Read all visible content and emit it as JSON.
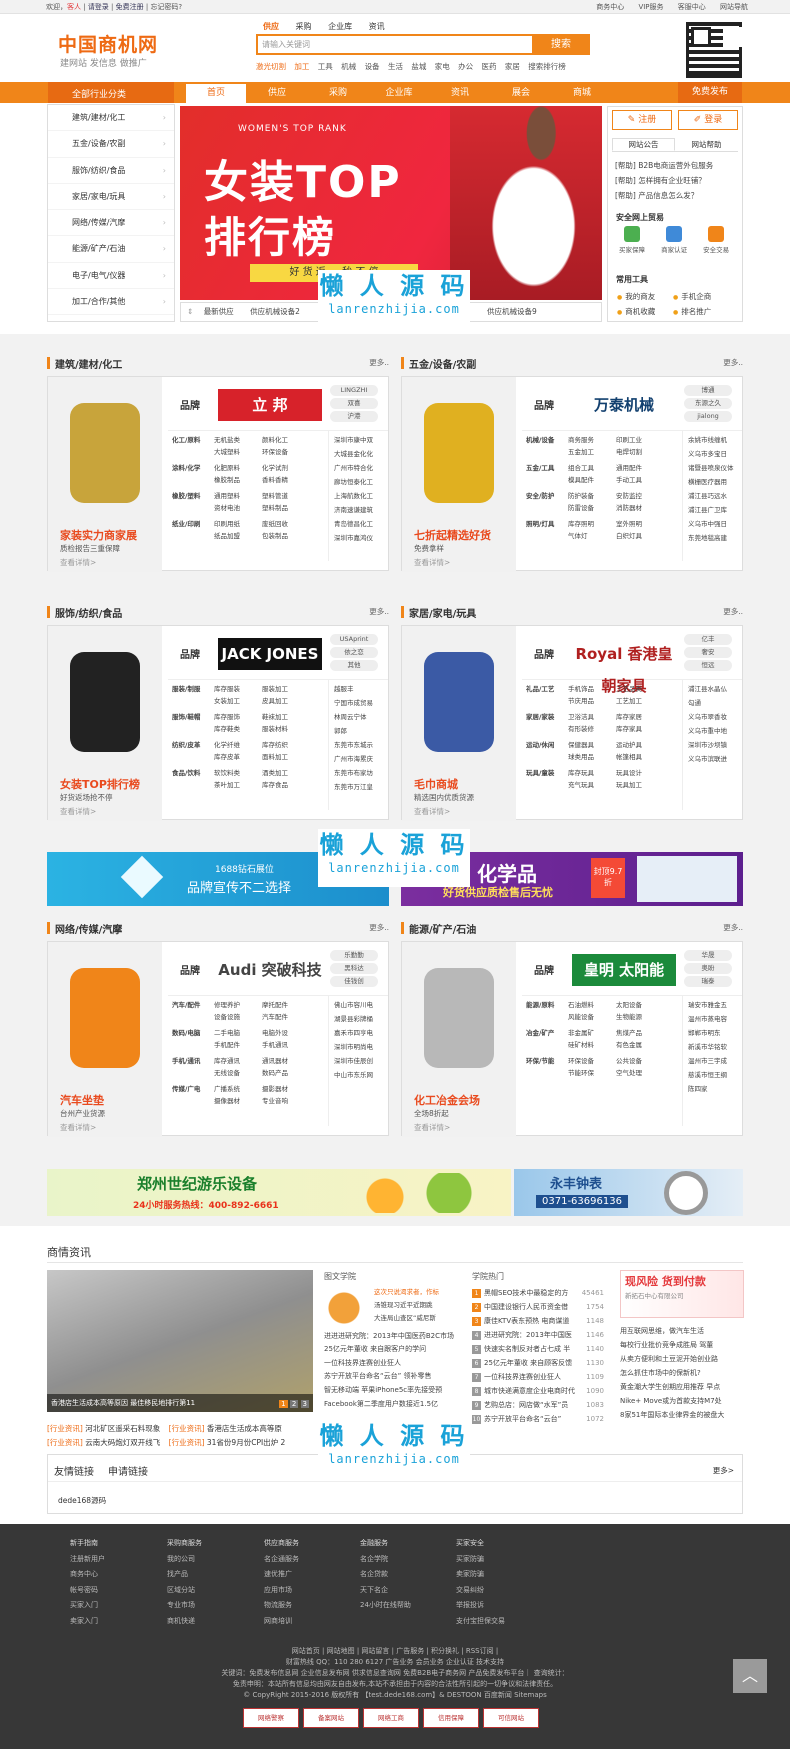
{
  "topbar": {
    "left_prefix": "欢迎，",
    "guest": "客人",
    "login": "请登录",
    "register": "免费注册",
    "forgot": "忘记密码?",
    "right": [
      "商务中心",
      "VIP服务",
      "客服中心",
      "网站导航"
    ]
  },
  "header": {
    "logo": "中国商机网",
    "slogan": "建网站 发信息 做推广",
    "search_tabs": [
      "供应",
      "采购",
      "企业库",
      "资讯"
    ],
    "search_placeholder": "请输入关键词",
    "search_button": "搜索",
    "hot": [
      "激光切割",
      "加工",
      "工具",
      "机械",
      "设备",
      "生活",
      "盐城",
      "家电",
      "办公",
      "医药",
      "家居",
      "搜索排行榜"
    ]
  },
  "nav": {
    "category": "全部行业分类",
    "items": [
      "首页",
      "供应",
      "采购",
      "企业库",
      "资讯",
      "展会",
      "商城"
    ],
    "right": "免费发布"
  },
  "categories": [
    "建筑/建材/化工",
    "五金/设备/农副",
    "服饰/纺织/食品",
    "家居/家电/玩具",
    "网络/传媒/汽摩",
    "能源/矿产/石油",
    "电子/电气/仪器",
    "加工/合作/其他"
  ],
  "banner": {
    "t1": "WOMEN'S TOP RANK",
    "t2": "女装TOP",
    "t3": "排行榜",
    "t4": "好 货 返 … 秒 不 停"
  },
  "ticker": {
    "label": "最新供应",
    "items": [
      "供应机械设备2",
      "供应机械设备9"
    ]
  },
  "userbox": {
    "register": "注册",
    "login": "登录",
    "tabs": [
      "网站公告",
      "网站帮助"
    ],
    "notices": [
      "[帮助] B2B电商运营外包服务",
      "[帮助] 怎样拥有企业旺铺？",
      "[帮助] 产品信息怎么发？"
    ],
    "trade_title": "安全网上贸易",
    "trade_items": [
      "买家保障",
      "商家认证",
      "安全交易"
    ],
    "tools_title": "常用工具",
    "tools": [
      "我的商友",
      "手机企商",
      "商机收藏",
      "排名推广"
    ]
  },
  "sections": [
    {
      "title": "建筑/建材/化工",
      "more": "更多..",
      "caption": "家装实力商家展",
      "sub": "质检报告三重保障",
      "detail": "查看详情>",
      "brand_label": "品牌",
      "brand_logo": "立 邦",
      "tags": [
        "LINGZHI",
        "双喜",
        "沪港"
      ],
      "rows": [
        [
          "化工/原料",
          "无机盐类",
          "颜料化工"
        ],
        [
          "涂料/化学",
          "化肥原料",
          "化学试剂"
        ],
        [
          "橡胶/塑料",
          "通用塑料",
          "塑料管道"
        ],
        [
          "纸业/印刷",
          "印刷用纸",
          "废纸回收"
        ]
      ],
      "col2": [
        "大城塑料",
        "橡胶制品",
        "资材电池",
        "纸品加盟"
      ],
      "col3": [
        "环保设备",
        "香料香精",
        "塑料制品",
        "包装制品"
      ],
      "places": [
        "深圳市康中双",
        "大城县金化化",
        "广州市特合化",
        "廊坊恒泰化工",
        "上海航数化工",
        "济南速谦建筑",
        "青岛德昌化工",
        "深圳市嘉鸿仪"
      ]
    },
    {
      "title": "五金/设备/农副",
      "more": "更多..",
      "caption": "七折起精选好货",
      "sub": "免费拿样",
      "detail": "查看详情>",
      "brand_label": "品牌",
      "brand_logo": "万泰机械",
      "tags": [
        "博通",
        "东源之久",
        "jialong"
      ],
      "rows": [
        [
          "机械/设备",
          "商务服务",
          "印刷工业"
        ],
        [
          "五金/工具",
          "组合工具",
          "通用配件"
        ],
        [
          "安全/防护",
          "防护装备",
          "安防监控"
        ],
        [
          "照明/灯具",
          "库存照明",
          "室外照明"
        ]
      ],
      "col2": [
        "五金加工",
        "模具配件",
        "防雷设备",
        "气体灯"
      ],
      "col3": [
        "电焊切割",
        "手动工具",
        "消防器材",
        "白织灯具"
      ],
      "places": [
        "余姚市线缠机",
        "义乌市多宝日",
        "诸暨县喷泉仪体",
        "横栅医疗器用",
        "浦江县巧远水",
        "浦江县广卫库",
        "义乌市中强日",
        "东莞地毯高建"
      ]
    },
    {
      "title": "服饰/纺织/食品",
      "more": "更多..",
      "caption": "女装TOP排行榜",
      "sub": "好货返场抢不停",
      "detail": "查看详情>",
      "brand_label": "品牌",
      "brand_logo": "JACK JONES",
      "tags": [
        "USAprint",
        "依之恋",
        "其他"
      ],
      "rows": [
        [
          "服装/制服",
          "库存服装",
          "服装加工"
        ],
        [
          "服饰/鞋帽",
          "库存服饰",
          "鞋袜加工"
        ],
        [
          "纺织/皮革",
          "化学纤维",
          "库存纺织"
        ],
        [
          "食品/饮料",
          "软饮料类",
          "酒类加工"
        ]
      ],
      "col2": [
        "女装加工",
        "库存鞋类",
        "库存皮革",
        "茶叶加工"
      ],
      "col3": [
        "皮具加工",
        "服装材料",
        "面料加工",
        "库存食品"
      ],
      "places": [
        "越服丰",
        "宁国市成贸易",
        "林周云宁体",
        "郭郎",
        "东莞市东城示",
        "广州市海累庆",
        "东莞市布家坊",
        "东莞市万江皇"
      ]
    },
    {
      "title": "家居/家电/玩具",
      "more": "更多..",
      "caption": "毛巾商城",
      "sub": "精选国内优质货源",
      "detail": "查看详情>",
      "brand_label": "品牌",
      "brand_logo": "Royal 香港皇朝家具",
      "tags": [
        "亿丰",
        "奢安",
        "恒远"
      ],
      "rows": [
        [
          "礼品/工艺",
          "手机饰品",
          "工艺品类"
        ],
        [
          "家居/家装",
          "卫浴洁具",
          "库存家居"
        ],
        [
          "运动/休闲",
          "保健器具",
          "运动护具"
        ],
        [
          "玩具/童装",
          "库存玩具",
          "玩具设计"
        ]
      ],
      "col2": [
        "节庆用品",
        "有形装修",
        "球类用品",
        "充气玩具"
      ],
      "col3": [
        "工艺加工",
        "库存家具",
        "帐篷相具",
        "玩具加工"
      ],
      "places": [
        "浦江县水晶仏",
        "勾通",
        "义乌市翠香妆",
        "义乌市重中地",
        "深圳市沙坝镇",
        "义乌市滨联进",
        "",
        ""
      ]
    },
    {
      "title": "网络/传媒/汽摩",
      "more": "更多..",
      "caption": "汽车坐垫",
      "sub": "台州产业货源",
      "detail": "查看详情>",
      "brand_label": "品牌",
      "brand_logo": "Audi 突破科技",
      "tags": [
        "乐勤勤",
        "黑科达",
        "佳钱创"
      ],
      "rows": [
        [
          "汽车/配件",
          "修理养护",
          "摩托配件"
        ],
        [
          "数码/电脑",
          "二手电脑",
          "电脑外设"
        ],
        [
          "手机/通讯",
          "库存通讯",
          "通讯器材"
        ],
        [
          "传媒/广电",
          "广播系统",
          "摄影器材"
        ]
      ],
      "col2": [
        "设备设施",
        "手机配件",
        "无线设备",
        "摄像器材"
      ],
      "col3": [
        "汽车配件",
        "手机通讯",
        "数码产品",
        "专业音响"
      ],
      "places": [
        "佛山市容川电",
        "湖景县彩牌桶",
        "嘉禾市四亨电",
        "深圳市明尚电",
        "深圳市佳辰创",
        "中山市东乐网",
        "",
        ""
      ]
    },
    {
      "title": "能源/矿产/石油",
      "more": "更多..",
      "caption": "化工冶金会场",
      "sub": "全场8折起",
      "detail": "查看详情>",
      "brand_label": "品牌",
      "brand_logo": "皇明 太阳能",
      "tags": [
        "华晟",
        "奥盼",
        "瑞泰"
      ],
      "rows": [
        [
          "能源/原料",
          "石油燃料",
          "太阳设备"
        ],
        [
          "冶金/矿产",
          "非金属矿",
          "焦煤产品"
        ],
        [
          "环保/节能",
          "环保设备",
          "公共设备"
        ],
        [
          "",
          "",
          ""
        ]
      ],
      "col2": [
        "风能设备",
        "硅矿材料",
        "节能环保"
      ],
      "col3": [
        "生物能源",
        "有色金属",
        "空气处理"
      ],
      "places": [
        "瑞安市雅金五",
        "温州市蒸电容",
        "邯郸市明东",
        "新溪市华铭软",
        "温州市三宇成",
        "慈溪市恒王纲",
        "陈四家",
        ""
      ]
    }
  ],
  "ads": {
    "ad1_title": "1688钻石展位",
    "ad1_sub": "品牌宣传不二选择",
    "ad2_title": "化学品",
    "ad2_sub": "好货供应质检售后无忧",
    "ad2_badge": "封顶9.7折",
    "ad3_title": "郑州世纪游乐设备",
    "ad3_sub": "24小时服务热线：400-892-6661",
    "ad4_title": "永丰钟表",
    "ad4_sub": "0371-63696136"
  },
  "news": {
    "title": "商情资讯",
    "pic_caption": "香港店生活成本高等原因 最佳移民地排行第11",
    "pages": [
      "1",
      "2",
      "3"
    ],
    "bottom": [
      [
        "[行业资讯]",
        "河北矿区遥采石料现象"
      ],
      [
        "[行业资讯]",
        "云南大码炮灯双开线飞"
      ],
      [
        "[行业资讯]",
        "香港店生活成本高等原"
      ],
      [
        "[行业资讯]",
        "31省份9月份CPI出炉 2"
      ]
    ],
    "col2_title": "图文学院",
    "col2_lead": [
      "这次只说渴求者，作标",
      "汤锥现习近平近期跳",
      "大连局山查区“威尼斯"
    ],
    "col2_list": [
      "进进进研究院：2013年中国医药B2C市场",
      "25亿元年董收 来自跟客户的学问",
      "一位科技界连赛创业狂人",
      "苏宁开放平台命名“云台” 领补零售",
      "智无移动端 苹果iPhone5c率先接受预",
      "Facebook第二季度用户数接近1.5亿"
    ],
    "col3_title": "学院热门",
    "col3_list": [
      [
        "黑帽SEO技术中最稳定的方",
        "45461"
      ],
      [
        "中国建设银行人民币资金借",
        "1754"
      ],
      [
        "康佳KTV表东预热 电商谋道",
        "1148"
      ],
      [
        "进进研究院：2013年中国医",
        "1146"
      ],
      [
        "快速实名制反对者占七成 半",
        "1140"
      ],
      [
        "25亿元年董收 来自顾客反馈",
        "1130"
      ],
      [
        "一位科技界连赛创业狂人",
        "1109"
      ],
      [
        "城市快递满意度企业电商时代",
        "1090"
      ],
      [
        "艺购总店：网店做“水军”员",
        "1083"
      ],
      [
        "苏宁开放平台命名“云台”",
        "1072"
      ]
    ],
    "col4_ad": "现风险 货到付款",
    "col4_ad_sub": "新拓石中心有限公司",
    "col4_list": [
      "用互联网思维，做汽车生活",
      "每校行业批价竞争成胜局 驾董",
      "从卖方便利和土豆泥开始创业路",
      "怎么抓住市场中的保新机?",
      "黄金潮大学生创期应用推荐 早点",
      "Nike+ Move或为首款支持M7处",
      "8家51年国际本业律界金的被盘大"
    ]
  },
  "friend": {
    "tabs": [
      "友情链接",
      "申请链接"
    ],
    "more": "更多>",
    "links": [
      "dede168源码"
    ]
  },
  "footer": {
    "cols": [
      {
        "title": "新手指南",
        "items": [
          "注册新用户",
          "商务中心",
          "帐号密码",
          "买家入门",
          "卖家入门"
        ]
      },
      {
        "title": "采购商服务",
        "items": [
          "我的公司",
          "找产品",
          "区域分站",
          "专业市场",
          "商机快递"
        ]
      },
      {
        "title": "供应商服务",
        "items": [
          "名企通服务",
          "速优推广",
          "应用市场",
          "物流服务",
          "网商培训"
        ]
      },
      {
        "title": "金融服务",
        "items": [
          "名企学院",
          "名企贷款",
          "天下名企",
          "24小时在线帮助"
        ]
      },
      {
        "title": "买家安全",
        "items": [
          "买家防骗",
          "卖家防骗",
          "交易纠纷",
          "举报投诉",
          "支付宝担保交易"
        ]
      }
    ],
    "links": "网站首页 | 网站地图 | 网站留言 | 广告服务 | 积分换礼 | RSS订阅 |",
    "contact": "财富热线 QQ：110 280 6127  广告业务  会员业务  企业认证  技术支持",
    "keywords": "关键词：免费发布信息网 企业信息发布网 供求信息查询网 免费B2B电子商务网 产品免费发布平台｜ 查询统计：",
    "disclaimer": "免责申明：本站所有信息均由网友自由发布,本站不承担由于内容的合法性所引起的一切争议和法律责任。",
    "copyright": "© CopyRight 2015-2016 版权所有 【test.dede168.com】& DESTOON 百度新闻 Sitemaps",
    "badges": [
      "网络警察",
      "备案网站",
      "网络工商",
      "信用保障",
      "可信网站"
    ]
  },
  "watermark": {
    "cn": "懒 人 源 码",
    "en": "lanrenzhijia.com"
  }
}
